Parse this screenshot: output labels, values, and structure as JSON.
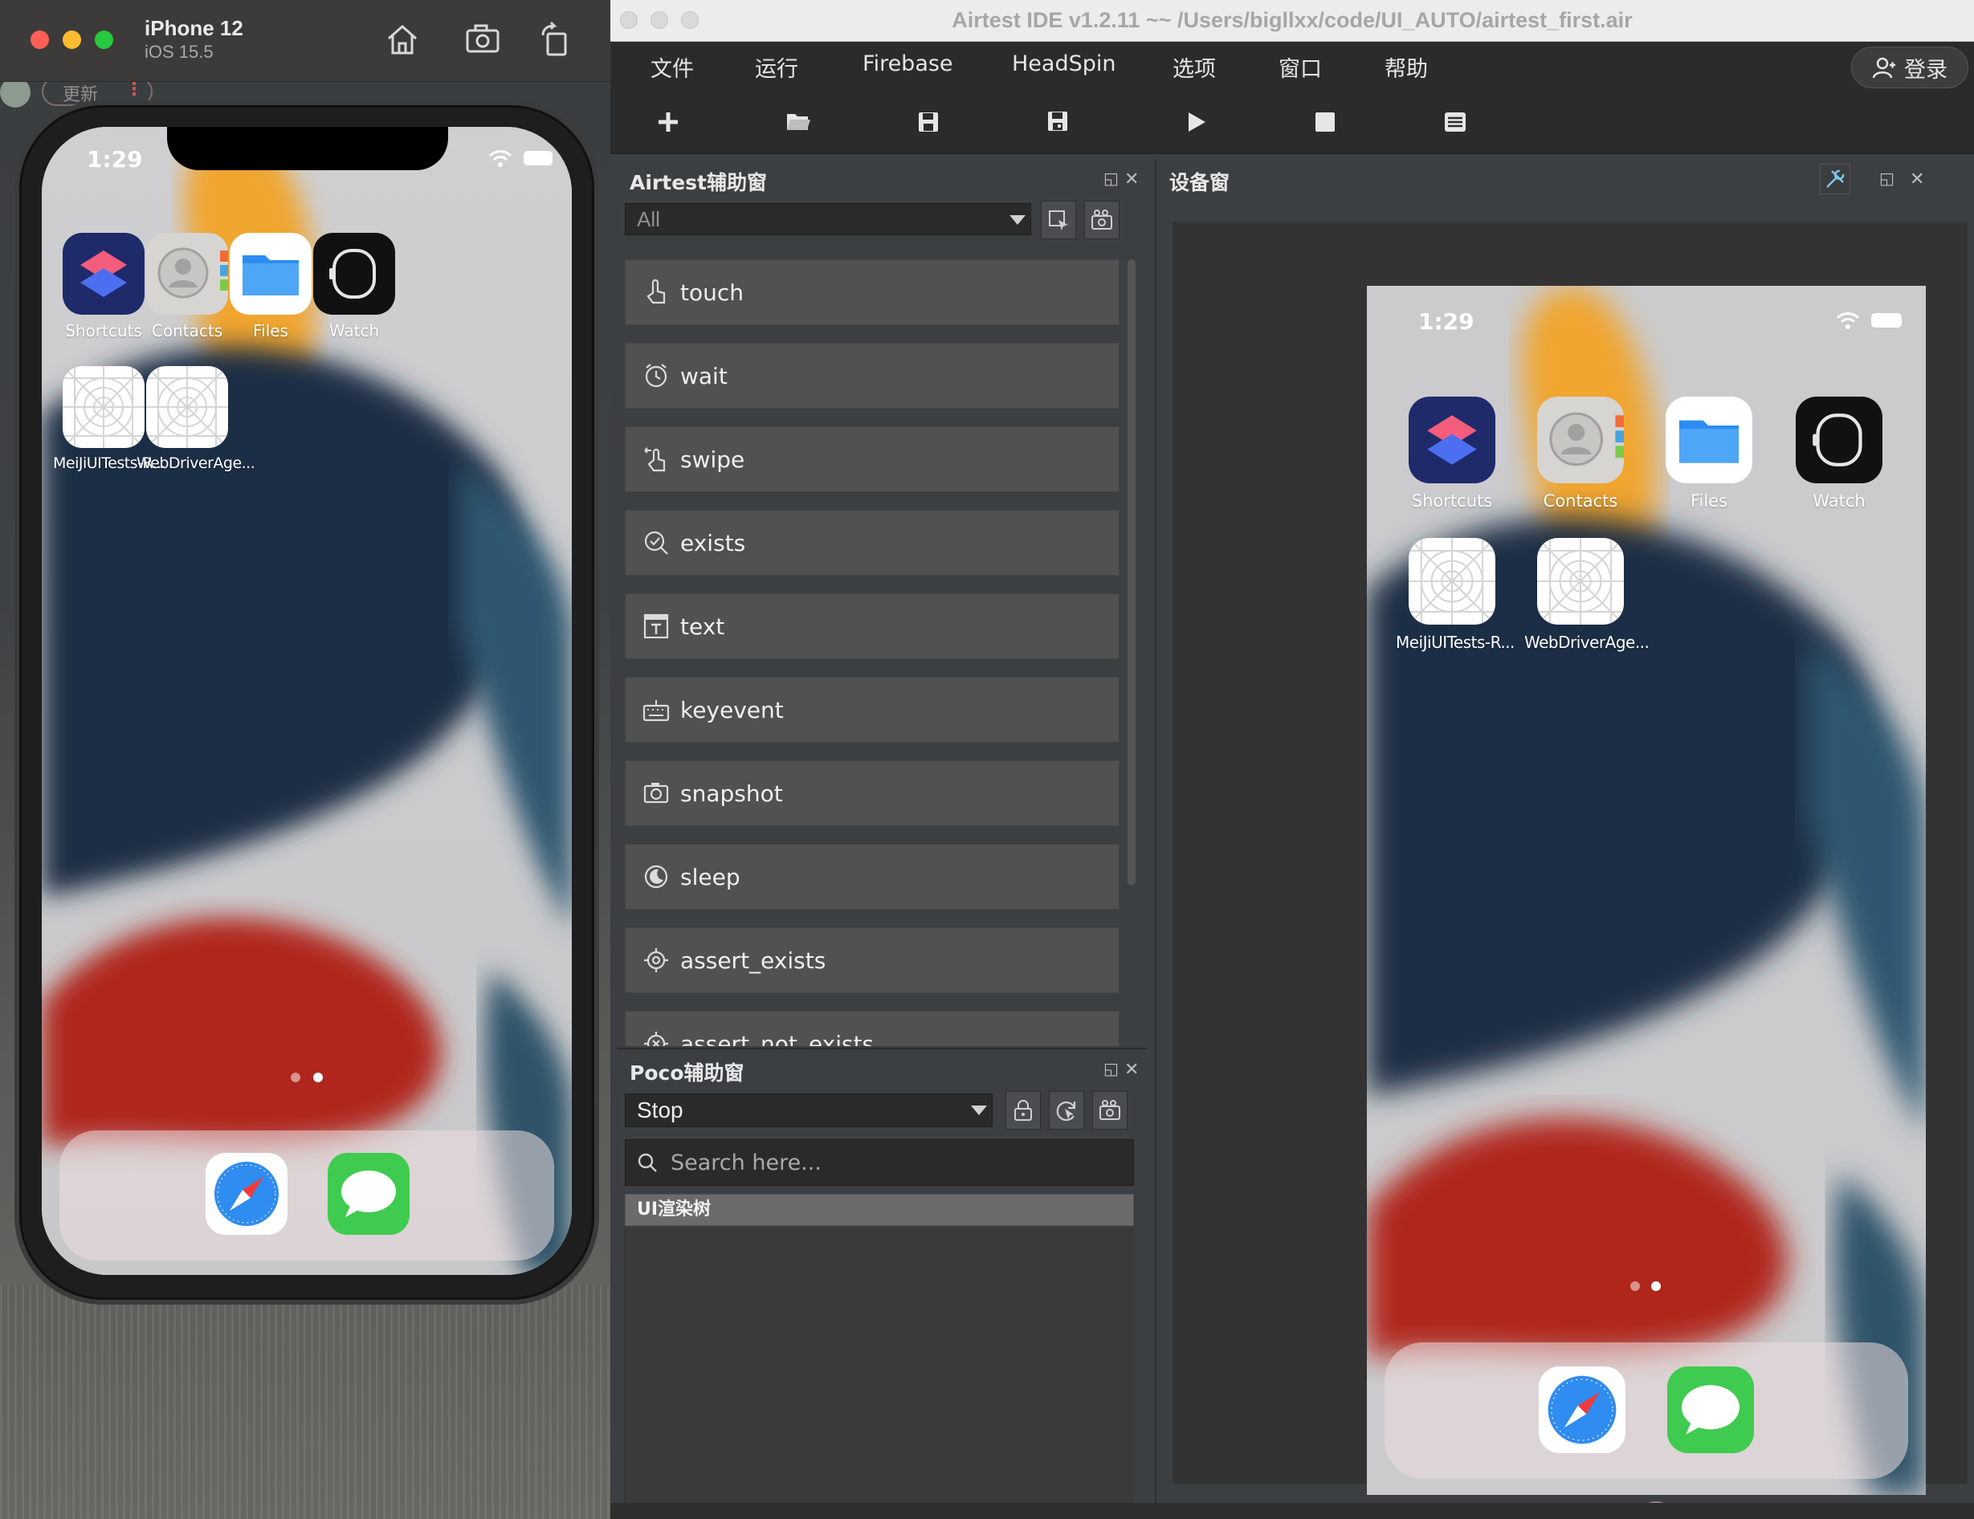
{
  "simulator": {
    "device_name": "iPhone 12",
    "os_version": "iOS 15.5",
    "behind_tab_label": "更新",
    "behind_tab_icon": "more-icon"
  },
  "ios": {
    "time": "1:29",
    "apps_row1": [
      {
        "name": "Shortcuts",
        "icon": "shortcuts-icon"
      },
      {
        "name": "Contacts",
        "icon": "contacts-icon"
      },
      {
        "name": "Files",
        "icon": "files-icon"
      },
      {
        "name": "Watch",
        "icon": "watch-icon"
      }
    ],
    "apps_row2": [
      {
        "name": "MeiJiUITests-R...",
        "icon": "placeholder-app-icon"
      },
      {
        "name": "WebDriverAge...",
        "icon": "placeholder-app-icon"
      }
    ],
    "dock": [
      {
        "name": "Safari",
        "icon": "safari-icon"
      },
      {
        "name": "Messages",
        "icon": "messages-icon"
      }
    ]
  },
  "ide": {
    "title": "Airtest IDE v1.2.11 ~~ /Users/bigllxx/code/UI_AUTO/airtest_first.air",
    "menu": [
      "文件",
      "运行",
      "Firebase",
      "HeadSpin",
      "选项",
      "窗口",
      "帮助"
    ],
    "login": "登录",
    "toolbar": [
      "new-icon",
      "open-folder-icon",
      "save-icon",
      "save-as-icon",
      "run-icon",
      "stop-icon",
      "log-icon"
    ]
  },
  "airtest_panel": {
    "title": "Airtest辅助窗",
    "filter_value": "All",
    "commands": [
      "touch",
      "wait",
      "swipe",
      "exists",
      "text",
      "keyevent",
      "snapshot",
      "sleep",
      "assert_exists",
      "assert_not_exists"
    ]
  },
  "poco_panel": {
    "title": "Poco辅助窗",
    "mode_value": "Stop",
    "search_placeholder": "Search here...",
    "tree_root": "UI渲染树"
  },
  "device_panel": {
    "title": "设备窗"
  },
  "colors": {
    "traffic_red": "#ff5f57",
    "traffic_yellow": "#febc2e",
    "traffic_green": "#28c840",
    "ide_bg": "#3c3f41",
    "command_bg": "#515151"
  }
}
